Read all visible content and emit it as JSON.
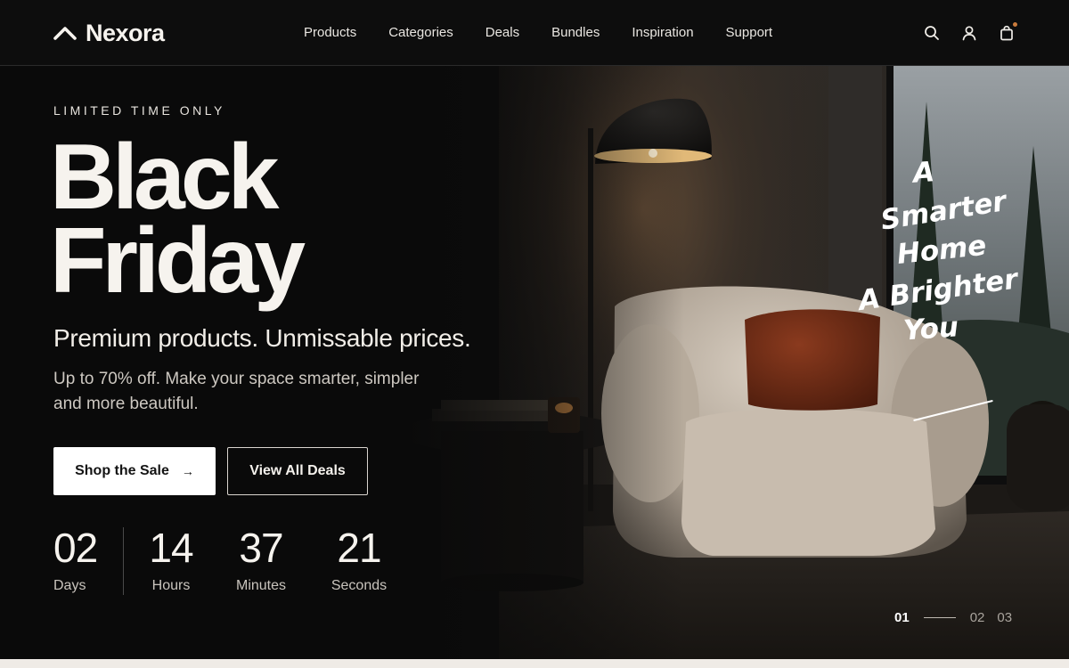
{
  "brand": {
    "name": "Nexora",
    "logo_icon": "chevron-up-logo-icon"
  },
  "nav": {
    "items": [
      {
        "label": "Products"
      },
      {
        "label": "Categories"
      },
      {
        "label": "Deals"
      },
      {
        "label": "Bundles"
      },
      {
        "label": "Inspiration"
      },
      {
        "label": "Support"
      }
    ]
  },
  "header_icons": [
    {
      "name": "search-icon"
    },
    {
      "name": "user-icon"
    },
    {
      "name": "shopping-bag-icon",
      "has_indicator": true
    }
  ],
  "hero": {
    "eyebrow": "LIMITED TIME ONLY",
    "headline_line1": "Black",
    "headline_line2": "Friday",
    "subhead": "Premium products. Unmissable prices.",
    "body": "Up to 70% off. Make your space smarter, simpler and more beautiful.",
    "cta_primary": "Shop the Sale",
    "cta_primary_icon": "arrow-right-icon",
    "cta_secondary": "View All Deals",
    "script_lines": [
      "A",
      "Smarter",
      "Home",
      "A Brighter",
      "You"
    ]
  },
  "countdown": [
    {
      "value": "02",
      "label": "Days"
    },
    {
      "value": "14",
      "label": "Hours"
    },
    {
      "value": "37",
      "label": "Minutes"
    },
    {
      "value": "21",
      "label": "Seconds"
    }
  ],
  "pager": {
    "items": [
      "01",
      "02",
      "03"
    ],
    "active_index": 0
  },
  "colors": {
    "background": "#0d0d0d",
    "accent_dot": "#c97a3b",
    "primary_button": "#ffffff",
    "footer_strip": "#efebe6"
  }
}
